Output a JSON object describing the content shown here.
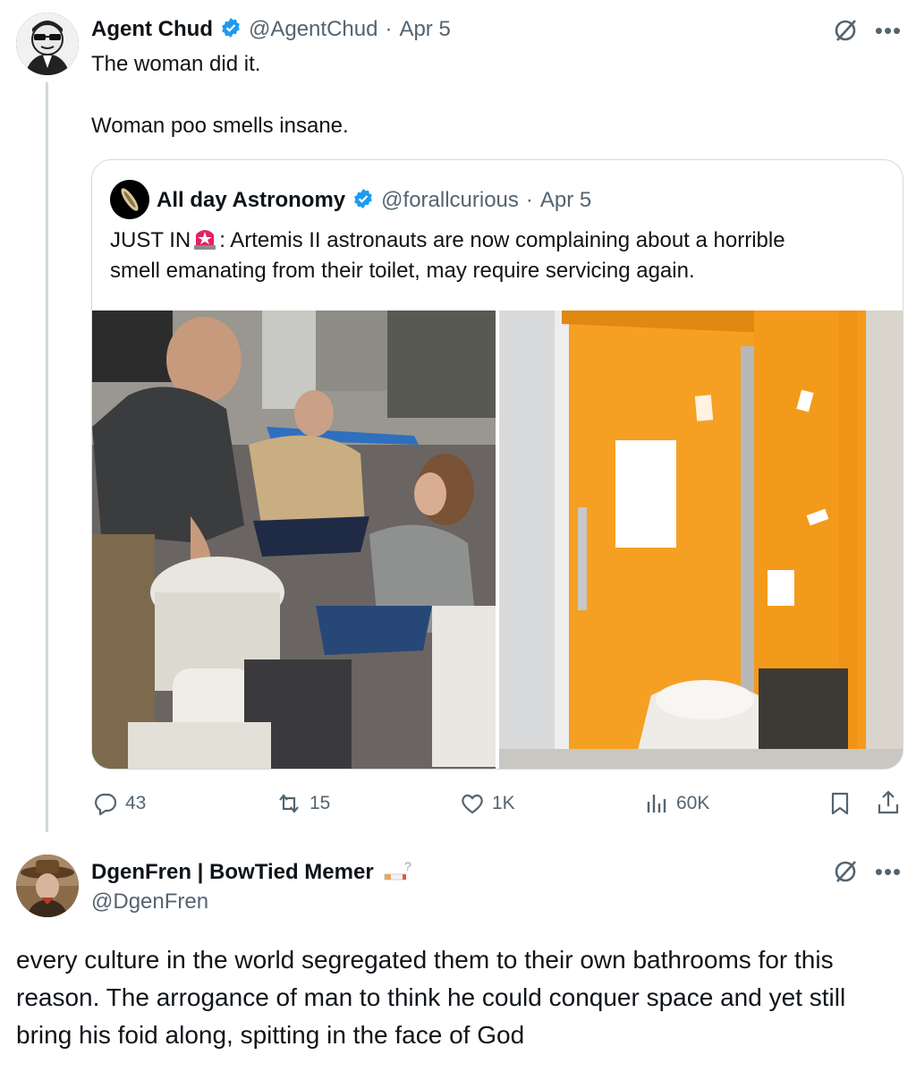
{
  "main_tweet": {
    "author_name": "Agent Chud",
    "author_handle": "@AgentChud",
    "separator": "·",
    "date": "Apr 5",
    "text_line1": "The woman did it.",
    "text_line2": "Woman poo smells insane.",
    "avatar_icon": "masked-agent-avatar",
    "verified_color": "#1d9bf0"
  },
  "quoted_tweet": {
    "author_name": "All day Astronomy",
    "author_handle": "@forallcurious",
    "separator": "·",
    "date": "Apr 5",
    "text_prefix": "JUST IN",
    "alert_icon": "police-light-emoji",
    "text_line1_rest": ": Artemis II astronauts are now complaining about a horrible",
    "text_line2": "smell emanating from their toilet, may require servicing again.",
    "images": [
      {
        "name": "astronauts-inspecting-toilet-photo"
      },
      {
        "name": "orion-toilet-compartment-photo"
      }
    ]
  },
  "actions": {
    "replies": "43",
    "reposts": "15",
    "likes": "1K",
    "views": "60K"
  },
  "reply_tweet": {
    "author_name": "DgenFren | BowTied Memer",
    "author_handle": "@DgenFren",
    "text_line1": "every culture in the world segregated them to their own bathrooms for this",
    "text_line2": "reason. The arrogance of man to think he could conquer space and yet still",
    "text_line3": "bring his foid along, spitting in the face of God"
  },
  "colors": {
    "accent": "#1d9bf0",
    "muted": "#536471",
    "border": "#cfd9de",
    "orange": "#f59b1c"
  }
}
